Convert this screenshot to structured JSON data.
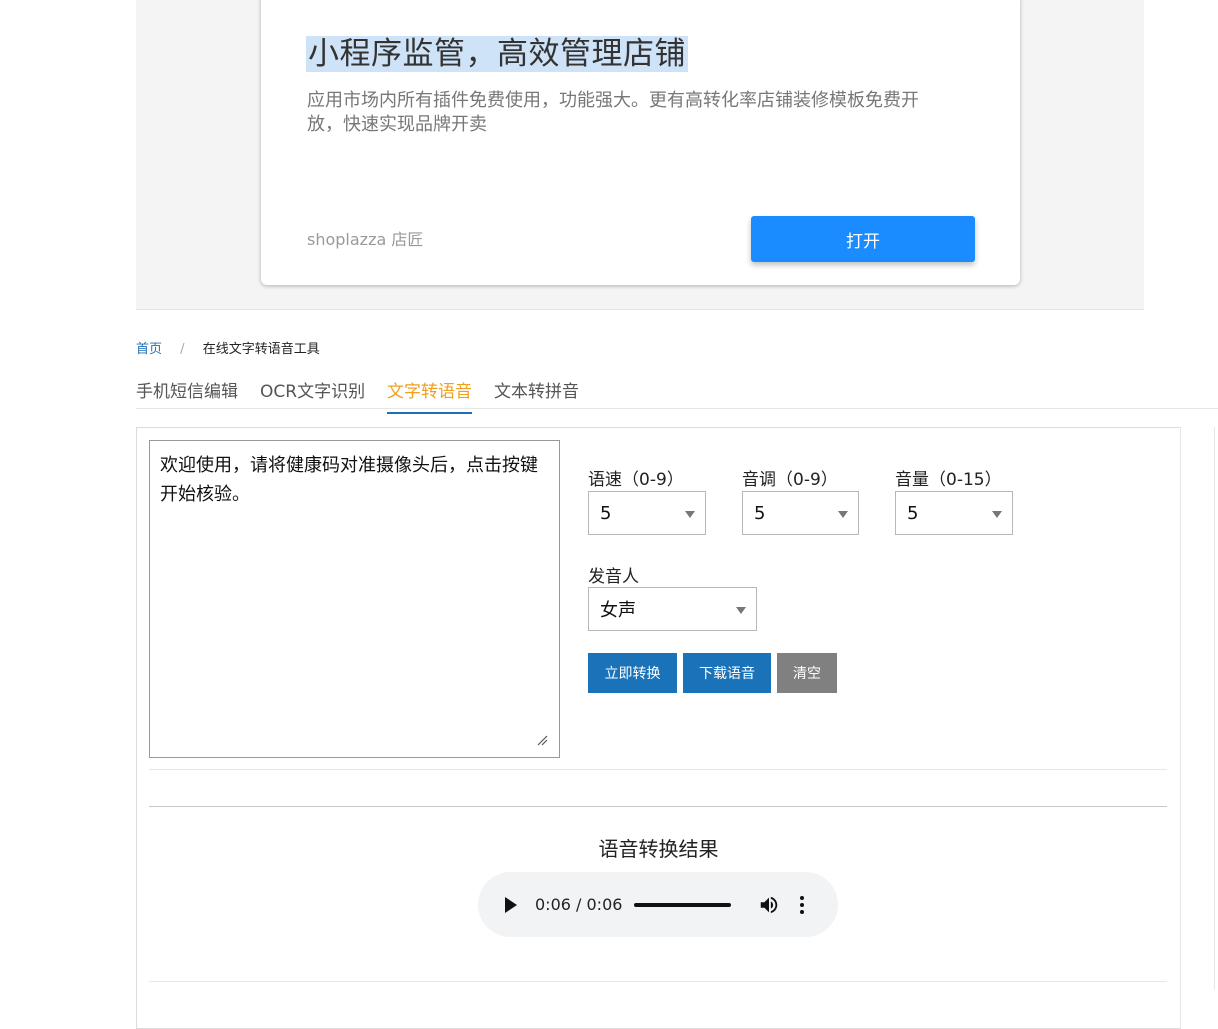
{
  "ad": {
    "title": "小程序监管，高效管理店铺",
    "description": "应用市场内所有插件免费使用，功能强大。更有高转化率店铺装修模板免费开放，快速实现品牌开卖",
    "brand": "shoplazza 店匠",
    "open_button": "打开",
    "accent_color": "#1a8cff"
  },
  "breadcrumb": {
    "home": "首页",
    "separator": "/",
    "current": "在线文字转语音工具"
  },
  "tabs": [
    {
      "label": "手机短信编辑",
      "active": false
    },
    {
      "label": "OCR文字识别",
      "active": false
    },
    {
      "label": "文字转语音",
      "active": true
    },
    {
      "label": "文本转拼音",
      "active": false
    }
  ],
  "form": {
    "text": "欢迎使用，请将健康码对准摄像头后，点击按键开始核验。",
    "speed_label": "语速（0-9）",
    "speed_value": "5",
    "pitch_label": "音调（0-9）",
    "pitch_value": "5",
    "volume_label": "音量（0-15）",
    "volume_value": "5",
    "voice_label": "发音人",
    "voice_value": "女声",
    "convert_button": "立即转换",
    "download_button": "下载语音",
    "clear_button": "清空"
  },
  "result": {
    "title": "语音转换结果",
    "time": "0:06 / 0:06",
    "progress": 1.0
  },
  "colors": {
    "active_tab": "#f0a020",
    "primary_button": "#1a73b8",
    "secondary_button": "#808080",
    "link": "#1e6fb8"
  }
}
